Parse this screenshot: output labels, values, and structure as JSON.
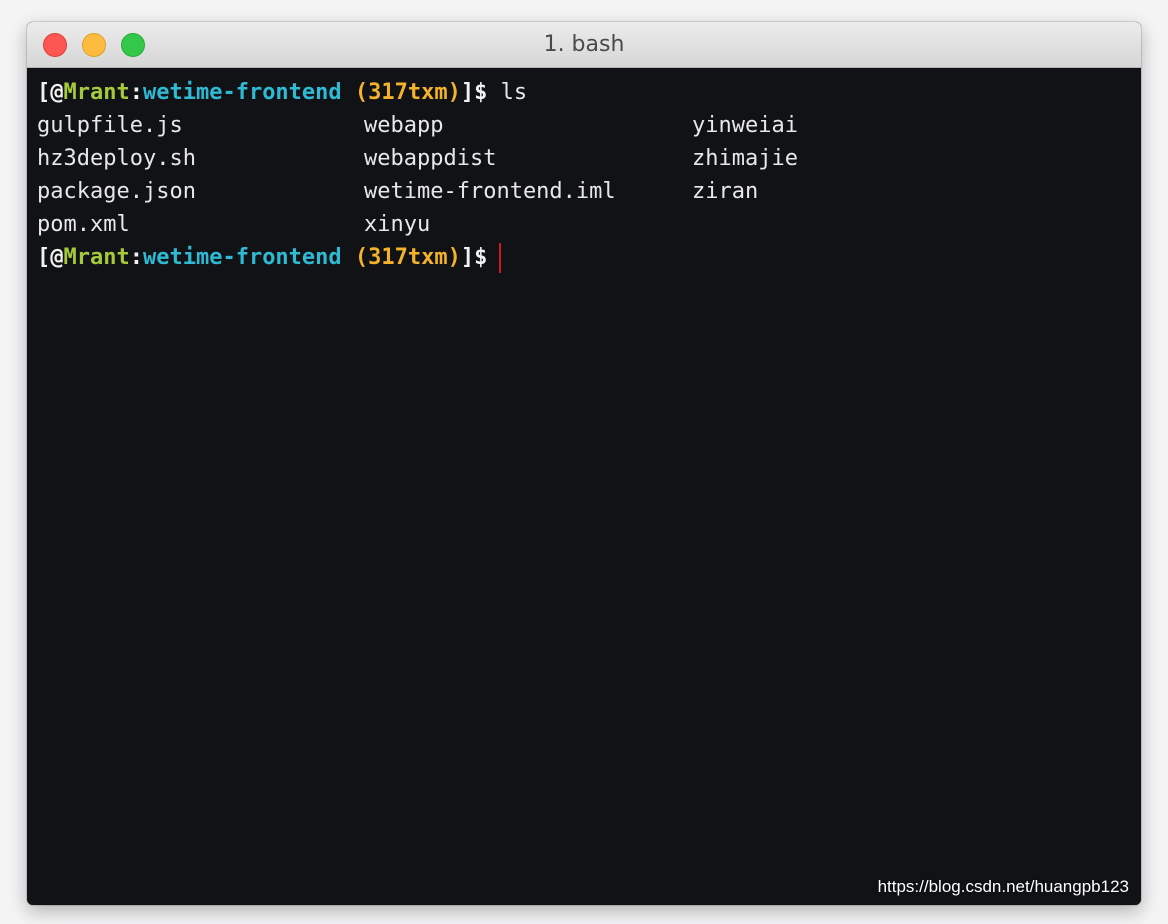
{
  "window": {
    "title": "1. bash"
  },
  "prompt": {
    "open": "[@",
    "user": "Mrant",
    "sep": ":",
    "path": "wetime-frontend",
    "branch": "(317txm)",
    "close": "]$"
  },
  "command": "ls",
  "listing": {
    "rows": [
      [
        "gulpfile.js",
        "webapp",
        "yinweiai"
      ],
      [
        "hz3deploy.sh",
        "webappdist",
        "zhimajie"
      ],
      [
        "package.json",
        "wetime-frontend.iml",
        "ziran"
      ],
      [
        "pom.xml",
        "xinyu",
        ""
      ]
    ]
  },
  "watermark": "https://blog.csdn.net/huangpb123",
  "colors": {
    "user": "#a4c93b",
    "path": "#2fb9d2",
    "branch": "#f3b22a",
    "cursor": "#d01818",
    "background": "#101216"
  }
}
